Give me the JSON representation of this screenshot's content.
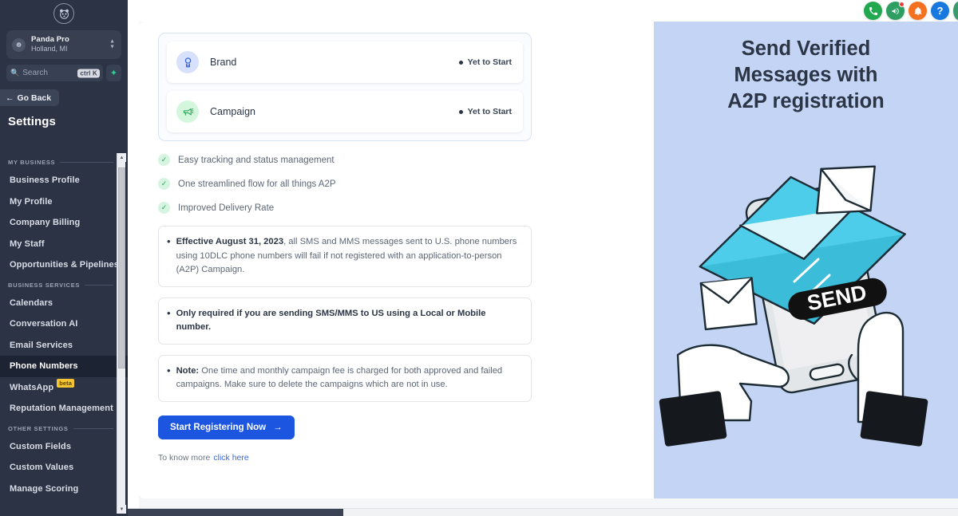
{
  "sidebar": {
    "logo_icon": "panda-logo-icon",
    "org": {
      "name": "Panda Pro",
      "location": "Holland, MI",
      "avatar_icon": "user-circle-icon",
      "caret_icon": "chevron-up-down-icon"
    },
    "search": {
      "placeholder": "Search",
      "icon": "search-icon",
      "shortcut": "ctrl K",
      "spark_icon": "sparkle-icon"
    },
    "go_back": {
      "label": "Go Back",
      "icon": "arrow-left-icon"
    },
    "title": "Settings",
    "groups": [
      {
        "label": "MY BUSINESS",
        "items": [
          {
            "label": "Business Profile",
            "active": false
          },
          {
            "label": "My Profile",
            "active": false
          },
          {
            "label": "Company Billing",
            "active": false
          },
          {
            "label": "My Staff",
            "active": false
          },
          {
            "label": "Opportunities & Pipelines",
            "active": false
          }
        ]
      },
      {
        "label": "BUSINESS SERVICES",
        "items": [
          {
            "label": "Calendars",
            "active": false
          },
          {
            "label": "Conversation AI",
            "active": false
          },
          {
            "label": "Email Services",
            "active": false
          },
          {
            "label": "Phone Numbers",
            "active": true
          },
          {
            "label": "WhatsApp",
            "active": false,
            "badge": "beta"
          },
          {
            "label": "Reputation Management",
            "active": false
          }
        ]
      },
      {
        "label": "OTHER SETTINGS",
        "items": [
          {
            "label": "Custom Fields",
            "active": false
          },
          {
            "label": "Custom Values",
            "active": false
          },
          {
            "label": "Manage Scoring",
            "active": false
          }
        ]
      }
    ]
  },
  "topbar": {
    "icons": [
      {
        "name": "phone-call-icon",
        "glyph": "☎",
        "color": "#22a84f",
        "badge": false
      },
      {
        "name": "announcement-megaphone-icon",
        "glyph": "⚑",
        "color": "#2f9e63",
        "badge": true
      },
      {
        "name": "notification-bell-icon",
        "glyph": "▲",
        "color": "#f4711f",
        "badge": false
      },
      {
        "name": "help-question-icon",
        "glyph": "?",
        "color": "#1779e0",
        "badge": false
      },
      {
        "name": "partial-icon",
        "glyph": "",
        "color": "#3c9a6d",
        "badge": false
      }
    ]
  },
  "registration": {
    "steps": [
      {
        "label": "Brand",
        "status": "Yet to Start",
        "icon": "brand-badge-icon"
      },
      {
        "label": "Campaign",
        "status": "Yet to Start",
        "icon": "campaign-megaphone-icon"
      }
    ],
    "benefits": [
      "Easy tracking and status management",
      "One streamlined flow for all things A2P",
      "Improved Delivery Rate"
    ],
    "notices": [
      {
        "bold": "Effective August 31, 2023",
        "rest": ", all SMS and MMS messages sent to U.S. phone numbers using 10DLC phone numbers will fail if not registered with an application-to-person (A2P) Campaign."
      },
      {
        "bold": "Only required if you are sending SMS/MMS to US using a Local or Mobile number.",
        "rest": ""
      },
      {
        "bold": "Note:",
        "rest": " One time and monthly campaign fee is charged for both approved and failed campaigns. Make sure to delete the campaigns which are not in use."
      }
    ],
    "cta": {
      "label": "Start Registering Now",
      "icon": "arrow-right-icon"
    },
    "footer": {
      "text": "To know more",
      "link": "click here"
    }
  },
  "promo": {
    "title_line1": "Send Verified",
    "title_line2": "Messages with",
    "title_line3": "A2P registration",
    "illustration_label": "SEND",
    "background": "#c3d4f5",
    "envelope_color": "#4ecdea"
  }
}
